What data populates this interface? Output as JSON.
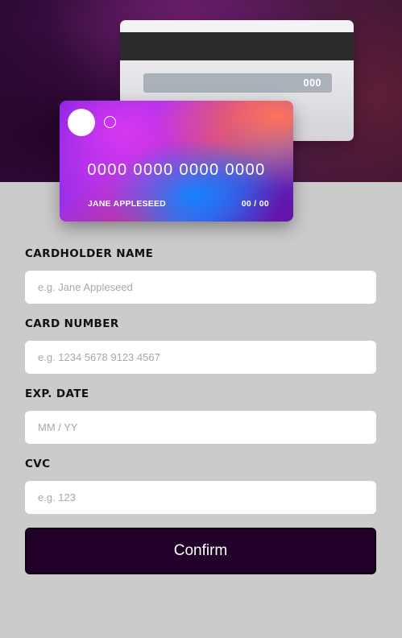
{
  "card_back": {
    "cvc": "000"
  },
  "card_front": {
    "number": "0000 0000 0000 0000",
    "holder_name": "JANE APPLESEED",
    "expiry": "00 / 00"
  },
  "form": {
    "fields": [
      {
        "label": "CARDHOLDER NAME",
        "placeholder": "e.g. Jane Appleseed",
        "value": ""
      },
      {
        "label": "CARD NUMBER",
        "placeholder": "e.g. 1234 5678 9123 4567",
        "value": ""
      },
      {
        "label": "EXP. DATE",
        "placeholder": "MM / YY",
        "value": ""
      },
      {
        "label": "CVC",
        "placeholder": "e.g. 123",
        "value": ""
      }
    ],
    "confirm_label": "Confirm"
  },
  "colors": {
    "page_background": "#cbcbcb",
    "button_background": "#21002a",
    "hero_dark": "#2c0a35"
  }
}
